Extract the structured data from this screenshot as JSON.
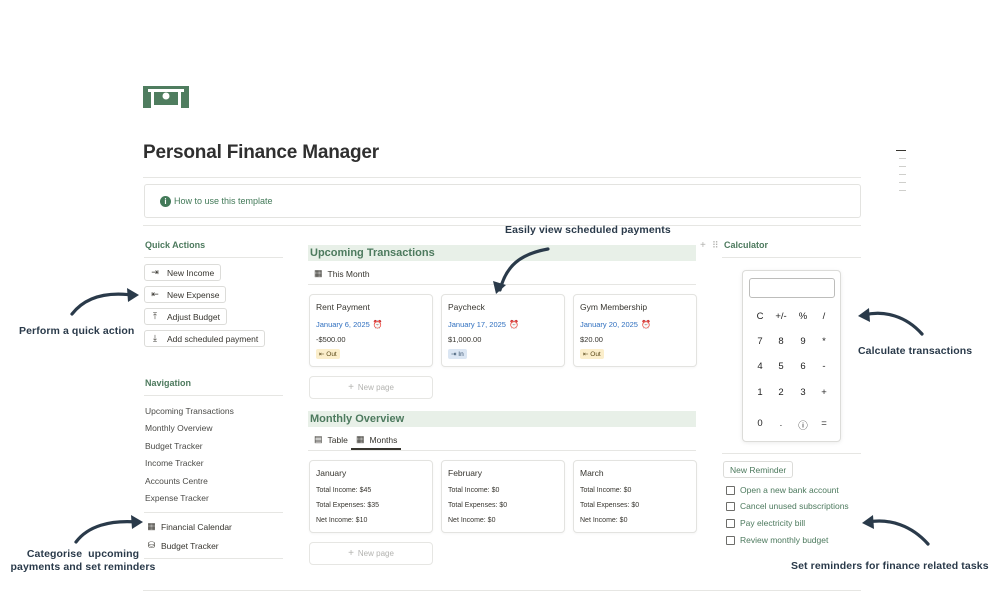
{
  "page": {
    "title": "Personal Finance Manager"
  },
  "callout": {
    "text": "How to use this template"
  },
  "quick_actions": {
    "heading": "Quick Actions",
    "buttons": [
      {
        "label": "New Income",
        "icon": "arrow-right-to-bar-icon"
      },
      {
        "label": "New Expense",
        "icon": "arrow-left-from-bar-icon"
      },
      {
        "label": "Adjust Budget",
        "icon": "arrow-up-from-bar-icon"
      },
      {
        "label": "Add scheduled payment",
        "icon": "download-icon"
      }
    ]
  },
  "navigation": {
    "heading": "Navigation",
    "links": [
      "Upcoming Transactions",
      "Monthly Overview",
      "Budget Tracker",
      "Income Tracker",
      "Accounts Centre",
      "Expense Tracker"
    ],
    "pages": [
      {
        "label": "Financial Calendar",
        "icon": "calendar-icon"
      },
      {
        "label": "Budget Tracker",
        "icon": "coins-icon"
      }
    ]
  },
  "upcoming": {
    "heading": "Upcoming Transactions",
    "view_tab": "This Month",
    "cards": [
      {
        "title": "Rent Payment",
        "date": "January 6, 2025",
        "amount": "-$500.00",
        "tag": "Out"
      },
      {
        "title": "Paycheck",
        "date": "January 17, 2025",
        "amount": "$1,000.00",
        "tag": "In"
      },
      {
        "title": "Gym Membership",
        "date": "January 20, 2025",
        "amount": "$20.00",
        "tag": "Out"
      }
    ],
    "new_page": "New page"
  },
  "monthly": {
    "heading": "Monthly Overview",
    "tabs": [
      "Table",
      "Months"
    ],
    "cards": [
      {
        "title": "January",
        "income": "Total Income: $45",
        "expenses": "Total Expenses: $35",
        "net": "Net Income: $10"
      },
      {
        "title": "February",
        "income": "Total Income: $0",
        "expenses": "Total Expenses: $0",
        "net": "Net Income: $0"
      },
      {
        "title": "March",
        "income": "Total Income: $0",
        "expenses": "Total Expenses: $0",
        "net": "Net Income: $0"
      }
    ],
    "new_page": "New page"
  },
  "calculator": {
    "heading": "Calculator",
    "keys": [
      [
        "C",
        "+/-",
        "%",
        "/"
      ],
      [
        "7",
        "8",
        "9",
        "*"
      ],
      [
        "4",
        "5",
        "6",
        "-"
      ],
      [
        "1",
        "2",
        "3",
        "+"
      ],
      [
        "0",
        ".",
        "ⓘ",
        "="
      ]
    ]
  },
  "reminders": {
    "button": "New Reminder",
    "items": [
      "Open a new bank account",
      "Cancel unused subscriptions",
      "Pay electricity bill",
      "Review monthly budget"
    ]
  },
  "annotations": {
    "scheduled": "Easily view scheduled payments",
    "quick_action": "Perform a quick action",
    "calculate": "Calculate transactions",
    "categorise_1": "Categorise  upcoming",
    "categorise_2": "payments and set reminders",
    "reminders": "Set reminders for finance related tasks"
  },
  "colors": {
    "accent": "#4d7a5e",
    "section_bg": "#e8f0e8",
    "date_blue": "#2f6fbf",
    "annotation": "#2a3a4a"
  }
}
